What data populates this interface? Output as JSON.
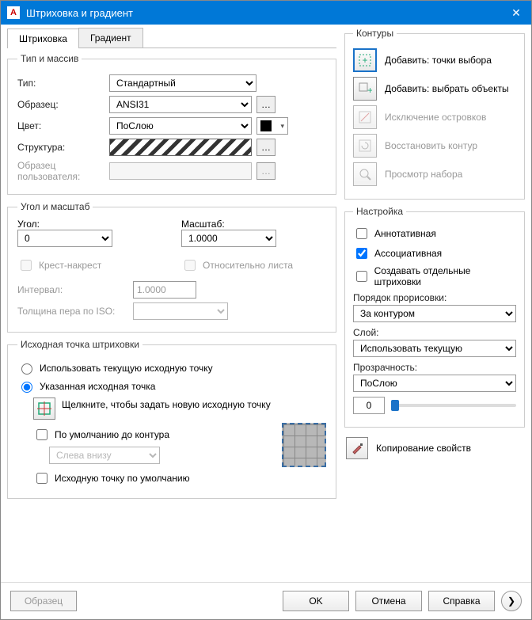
{
  "window": {
    "title": "Штриховка и градиент"
  },
  "tabs": {
    "hatch": "Штриховка",
    "gradient": "Градиент"
  },
  "typeArray": {
    "legend": "Тип и массив",
    "typeLabel": "Тип:",
    "typeValue": "Стандартный",
    "patternLabel": "Образец:",
    "patternValue": "ANSI31",
    "colorLabel": "Цвет:",
    "colorValue": "ПоСлою",
    "swatchLabel": "Структура:",
    "customLabel": "Образец пользователя:"
  },
  "angleScale": {
    "legend": "Угол и масштаб",
    "angleLabel": "Угол:",
    "angleValue": "0",
    "scaleLabel": "Масштаб:",
    "scaleValue": "1.0000",
    "doubleLabel": "Крест-накрест",
    "paperLabel": "Относительно листа",
    "spacingLabel": "Интервал:",
    "spacingValue": "1.0000",
    "isoLabel": "Толщина пера по ISO:"
  },
  "origin": {
    "legend": "Исходная точка штриховки",
    "useCurrent": "Использовать текущую исходную точку",
    "specified": "Указанная исходная точка",
    "clickText": "Щелкните, чтобы задать новую исходную точку",
    "defaultBoundary": "По умолчанию до контура",
    "positionValue": "Слева внизу",
    "storeDefault": "Исходную точку по умолчанию"
  },
  "boundaries": {
    "legend": "Контуры",
    "pickPoints": "Добавить: точки выбора",
    "selectObjects": "Добавить: выбрать объекты",
    "removeIslands": "Исключение островков",
    "recreate": "Восстановить контур",
    "viewSelections": "Просмотр набора"
  },
  "options": {
    "legend": "Настройка",
    "annotative": "Аннотативная",
    "associative": "Ассоциативная",
    "separate": "Создавать отдельные штриховки",
    "drawOrderLabel": "Порядок прорисовки:",
    "drawOrderValue": "За контуром",
    "layerLabel": "Слой:",
    "layerValue": "Использовать текущую",
    "transparencyLabel": "Прозрачность:",
    "transparencyMode": "ПоСлою",
    "transparencyValue": "0"
  },
  "inherit": {
    "label": "Копирование свойств"
  },
  "footer": {
    "preview": "Образец",
    "ok": "OK",
    "cancel": "Отмена",
    "help": "Справка"
  }
}
